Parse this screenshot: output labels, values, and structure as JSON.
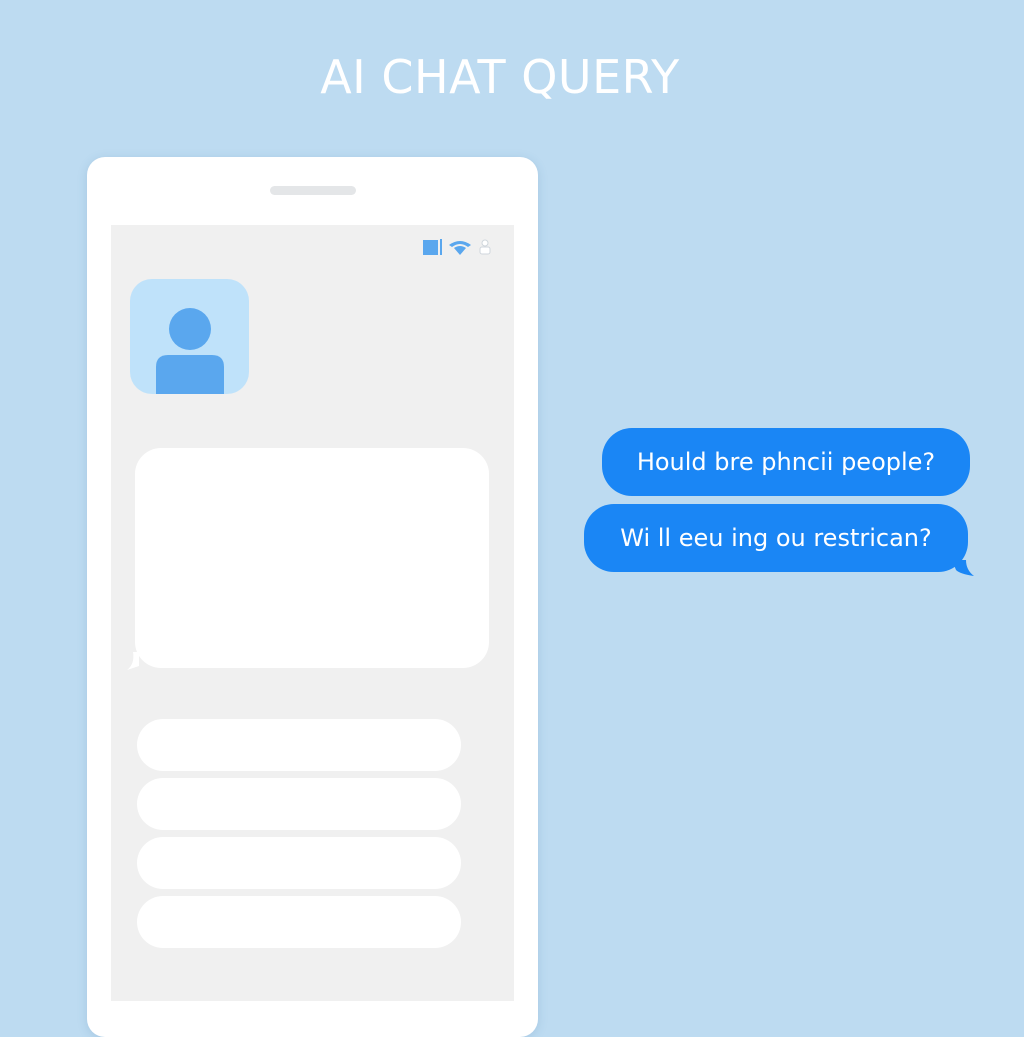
{
  "header": {
    "title": "AI CHAT QUERY"
  },
  "status_bar": {
    "icons": [
      "battery-icon",
      "wifi-icon",
      "person-icon"
    ]
  },
  "chat": {
    "avatar_icon": "user-avatar-icon",
    "queries": [
      "Hould bre phncii people?",
      "Wi ll ееu ing ou restrican?"
    ]
  },
  "colors": {
    "background": "#bddbf1",
    "accent": "#1a86f5",
    "avatar_bg": "#bfe2fa",
    "avatar_figure": "#5aa7ee",
    "screen": "#f0f0f0"
  }
}
